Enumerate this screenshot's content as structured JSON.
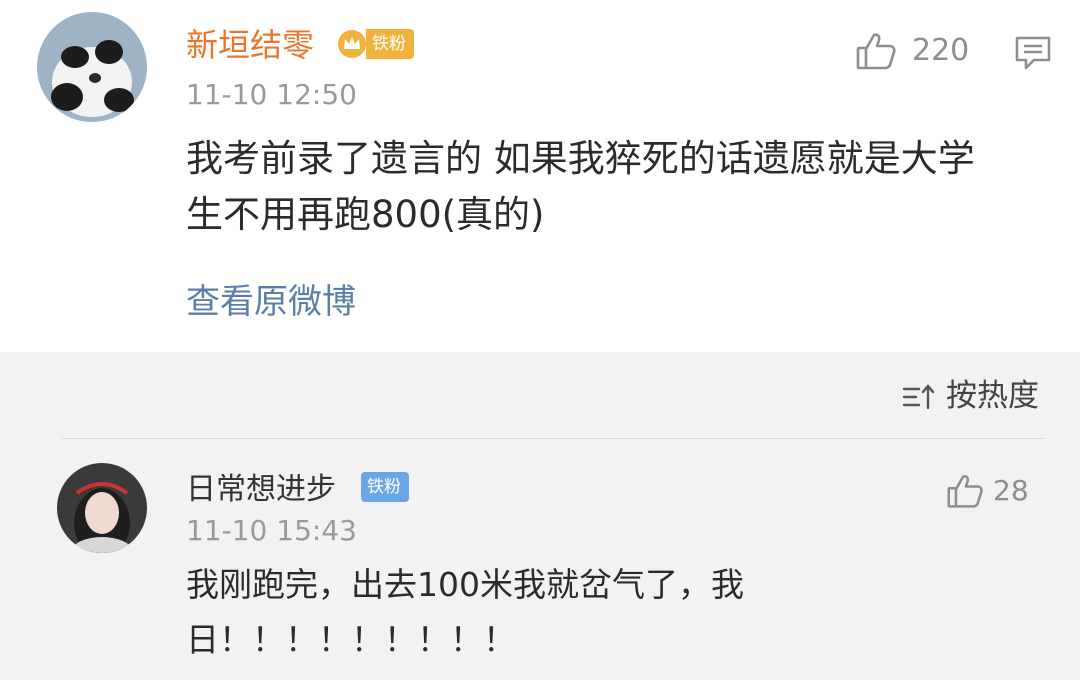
{
  "main_comment": {
    "username": "新垣结零",
    "badge": "铁粉",
    "timestamp": "11-10 12:50",
    "like_count": "220",
    "text_lines": [
      "我考前录了遗言的 如果我猝死的话遗愿就是大学",
      "生不用再跑800(真的)"
    ],
    "view_original_label": "查看原微博"
  },
  "sort": {
    "label": "按热度"
  },
  "reply": {
    "username": "日常想进步",
    "badge": "铁粉",
    "timestamp": "11-10 15:43",
    "like_count": "28",
    "text_lines": [
      "我刚跑完，出去100米我就岔气了，我",
      "日！！！！！！！！！"
    ]
  },
  "colors": {
    "username_orange": "#e8762d",
    "badge_gold": "#f0b43c",
    "badge_blue": "#6aa6e6",
    "link_blue": "#5b7fa8",
    "divider": "#dcdcdc",
    "reply_bg": "#f2f2f2"
  },
  "icons": [
    "thumbs-up-icon",
    "comment-icon",
    "sort-icon",
    "crown-icon"
  ]
}
